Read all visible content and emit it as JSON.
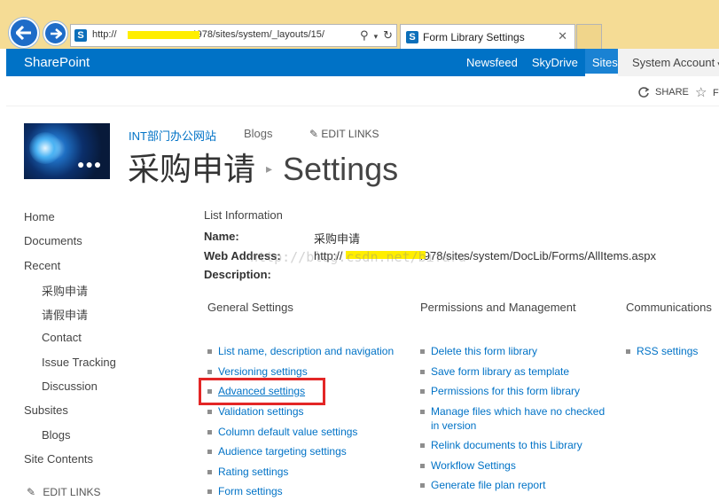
{
  "browser": {
    "address": "http://",
    "address_tail": "4978/sites/system/_layouts/15/",
    "tab_title": "Form Library Settings"
  },
  "suitebar": {
    "brand": "SharePoint",
    "links": [
      "Newsfeed",
      "SkyDrive",
      "Sites"
    ],
    "account": "System Account"
  },
  "ribbon": {
    "share": "SHARE",
    "follow_partial": "F"
  },
  "site": {
    "name": "INT部门办公网站",
    "blogs": "Blogs",
    "edit_links": "EDIT LINKS",
    "title_list": "采购申请",
    "title_page": "Settings"
  },
  "quick_launch": {
    "items": [
      {
        "label": "Home",
        "sub": false
      },
      {
        "label": "Documents",
        "sub": false
      },
      {
        "label": "Recent",
        "sub": false
      },
      {
        "label": "采购申请",
        "sub": true
      },
      {
        "label": "请假申请",
        "sub": true
      },
      {
        "label": "Contact",
        "sub": true
      },
      {
        "label": "Issue Tracking",
        "sub": true
      },
      {
        "label": "Discussion",
        "sub": true
      },
      {
        "label": "Subsites",
        "sub": false
      },
      {
        "label": "Blogs",
        "sub": true
      },
      {
        "label": "Site Contents",
        "sub": false
      }
    ],
    "edit_links": "EDIT LINKS"
  },
  "list_info": {
    "heading": "List Information",
    "name_label": "Name:",
    "name_value": "采购申请",
    "web_label": "Web Address:",
    "web_value_start": "http://",
    "web_value_end": "4978/sites/system/DocLib/Forms/AllItems.aspx",
    "desc_label": "Description:",
    "watermark": "http://blog.csdn.net/bifaru"
  },
  "general_settings": {
    "heading": "General Settings",
    "links": [
      "List name, description and navigation",
      "Versioning settings",
      "Advanced settings",
      "Validation settings",
      "Column default value settings",
      "Audience targeting settings",
      "Rating settings",
      "Form settings"
    ]
  },
  "permissions": {
    "heading": "Permissions and Management",
    "links": [
      "Delete this form library",
      "Save form library as template",
      "Permissions for this form library",
      "Manage files which have no checked in version",
      "Relink documents to this Library",
      "Workflow Settings",
      "Generate file plan report"
    ]
  },
  "communications": {
    "heading": "Communications",
    "links": [
      "RSS settings"
    ]
  },
  "colors": {
    "suitebar": "#0072c6",
    "link": "#0072c6",
    "highlight": "#e32626",
    "chrome": "#f5dc95"
  }
}
